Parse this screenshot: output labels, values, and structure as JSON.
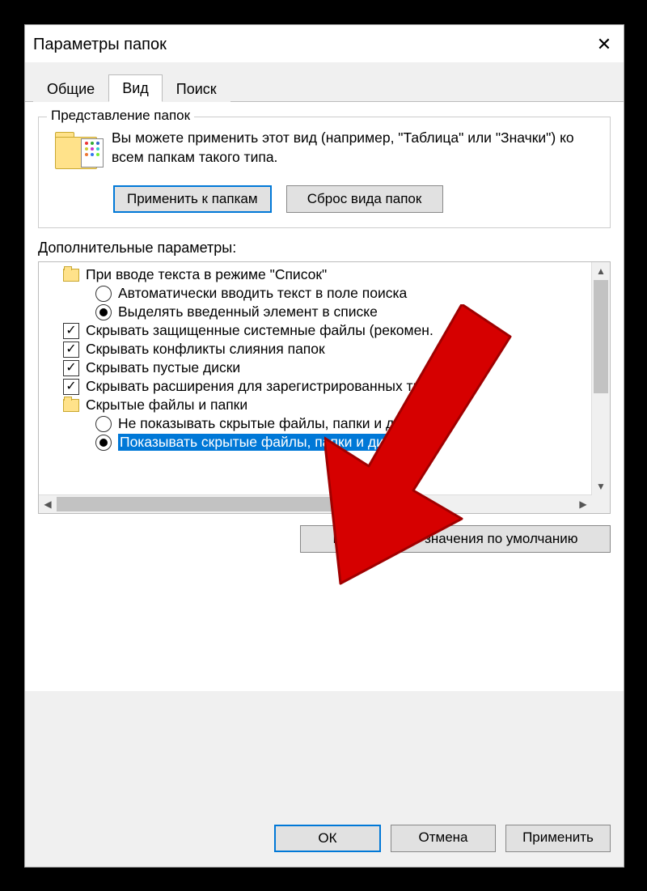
{
  "window": {
    "title": "Параметры папок"
  },
  "tabs": {
    "general": "Общие",
    "view": "Вид",
    "search": "Поиск"
  },
  "folder_views": {
    "legend": "Представление папок",
    "description": "Вы можете применить этот вид (например, \"Таблица\" или \"Значки\") ко всем папкам такого типа.",
    "apply_button": "Применить к папкам",
    "reset_button": "Сброс вида папок"
  },
  "advanced": {
    "label": "Дополнительные параметры:",
    "items": [
      {
        "kind": "folder",
        "depth": 1,
        "label": "При вводе текста в режиме \"Список\""
      },
      {
        "kind": "radio",
        "depth": 2,
        "checked": false,
        "label": "Автоматически вводить текст в поле поиска"
      },
      {
        "kind": "radio",
        "depth": 2,
        "checked": true,
        "label": "Выделять введенный элемент в списке"
      },
      {
        "kind": "check",
        "depth": 1,
        "checked": true,
        "label": "Скрывать защищенные системные файлы (рекомен."
      },
      {
        "kind": "check",
        "depth": 1,
        "checked": true,
        "label": "Скрывать конфликты слияния папок"
      },
      {
        "kind": "check",
        "depth": 1,
        "checked": true,
        "label": "Скрывать пустые диски"
      },
      {
        "kind": "check",
        "depth": 1,
        "checked": true,
        "label": "Скрывать расширения для зарегистрированных типо"
      },
      {
        "kind": "folder",
        "depth": 1,
        "label": "Скрытые файлы и папки"
      },
      {
        "kind": "radio",
        "depth": 2,
        "checked": false,
        "label": "Не показывать скрытые файлы, папки и диски"
      },
      {
        "kind": "radio",
        "depth": 2,
        "checked": true,
        "selected": true,
        "label": "Показывать скрытые файлы, папки и диски"
      }
    ],
    "restore_defaults": "Восстановить значения по умолчанию"
  },
  "dialog_buttons": {
    "ok": "ОК",
    "cancel": "Отмена",
    "apply": "Применить"
  }
}
